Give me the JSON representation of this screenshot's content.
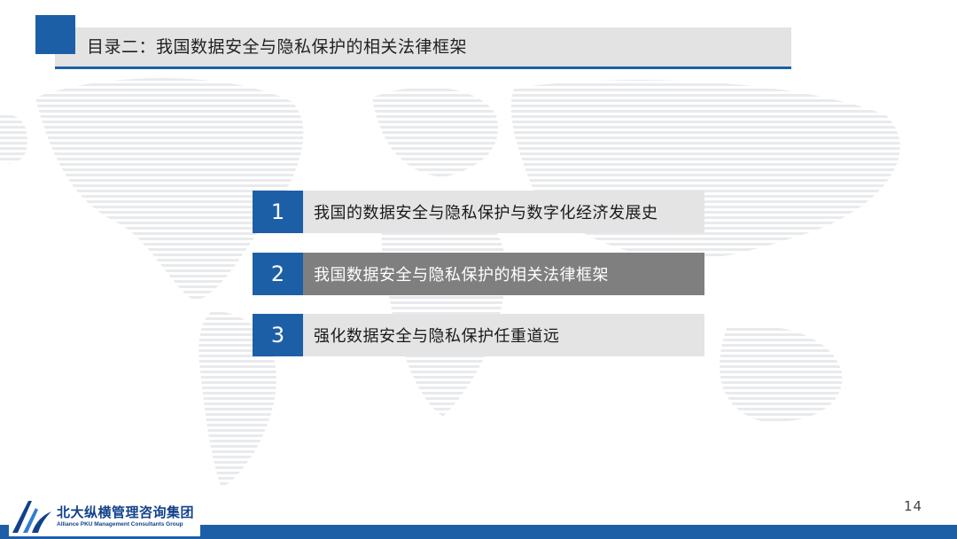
{
  "colors": {
    "accent": "#1d5fa7",
    "header_bg": "#e3e3e3",
    "item_bg": "#e4e4e4",
    "active_item_bg": "#7f7f7f"
  },
  "header": {
    "title": "目录二：我国数据安全与隐私保护的相关法律框架"
  },
  "agenda": [
    {
      "number": "1",
      "label": "我国的数据安全与隐私保护与数字化经济发展史",
      "active": false
    },
    {
      "number": "2",
      "label": "我国数据安全与隐私保护的相关法律框架",
      "active": true
    },
    {
      "number": "3",
      "label": "强化数据安全与隐私保护任重道远",
      "active": false
    }
  ],
  "page_number": "14",
  "logo": {
    "name_cn": "北大纵横管理咨询集团",
    "name_en": "Alliance PKU Management Consultants Group",
    "icon": "company-logo-icon"
  }
}
